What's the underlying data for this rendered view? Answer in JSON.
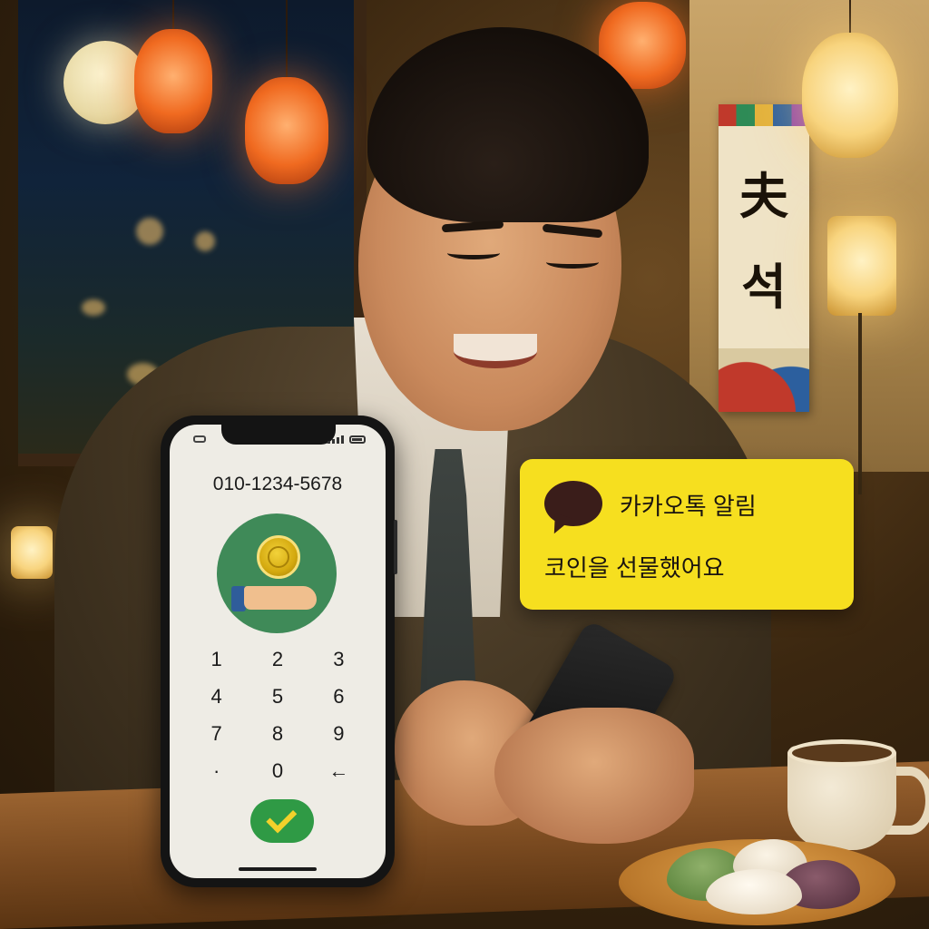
{
  "scene": {
    "banner_chars": [
      "夫",
      "석"
    ]
  },
  "phone": {
    "number_display": "010-1234-5678",
    "keypad": [
      "1",
      "2",
      "3",
      "4",
      "5",
      "6",
      "7",
      "8",
      "9",
      "·",
      "0",
      "←"
    ],
    "confirm_icon": "check-icon",
    "illustration_icon": "coin-hand-icon",
    "accent_color": "#2f9a45"
  },
  "notification": {
    "title": "카카오톡 알림",
    "message": "코인을 선물했어요",
    "icon": "speech-bubble-icon",
    "background_color": "#f6df1f"
  }
}
